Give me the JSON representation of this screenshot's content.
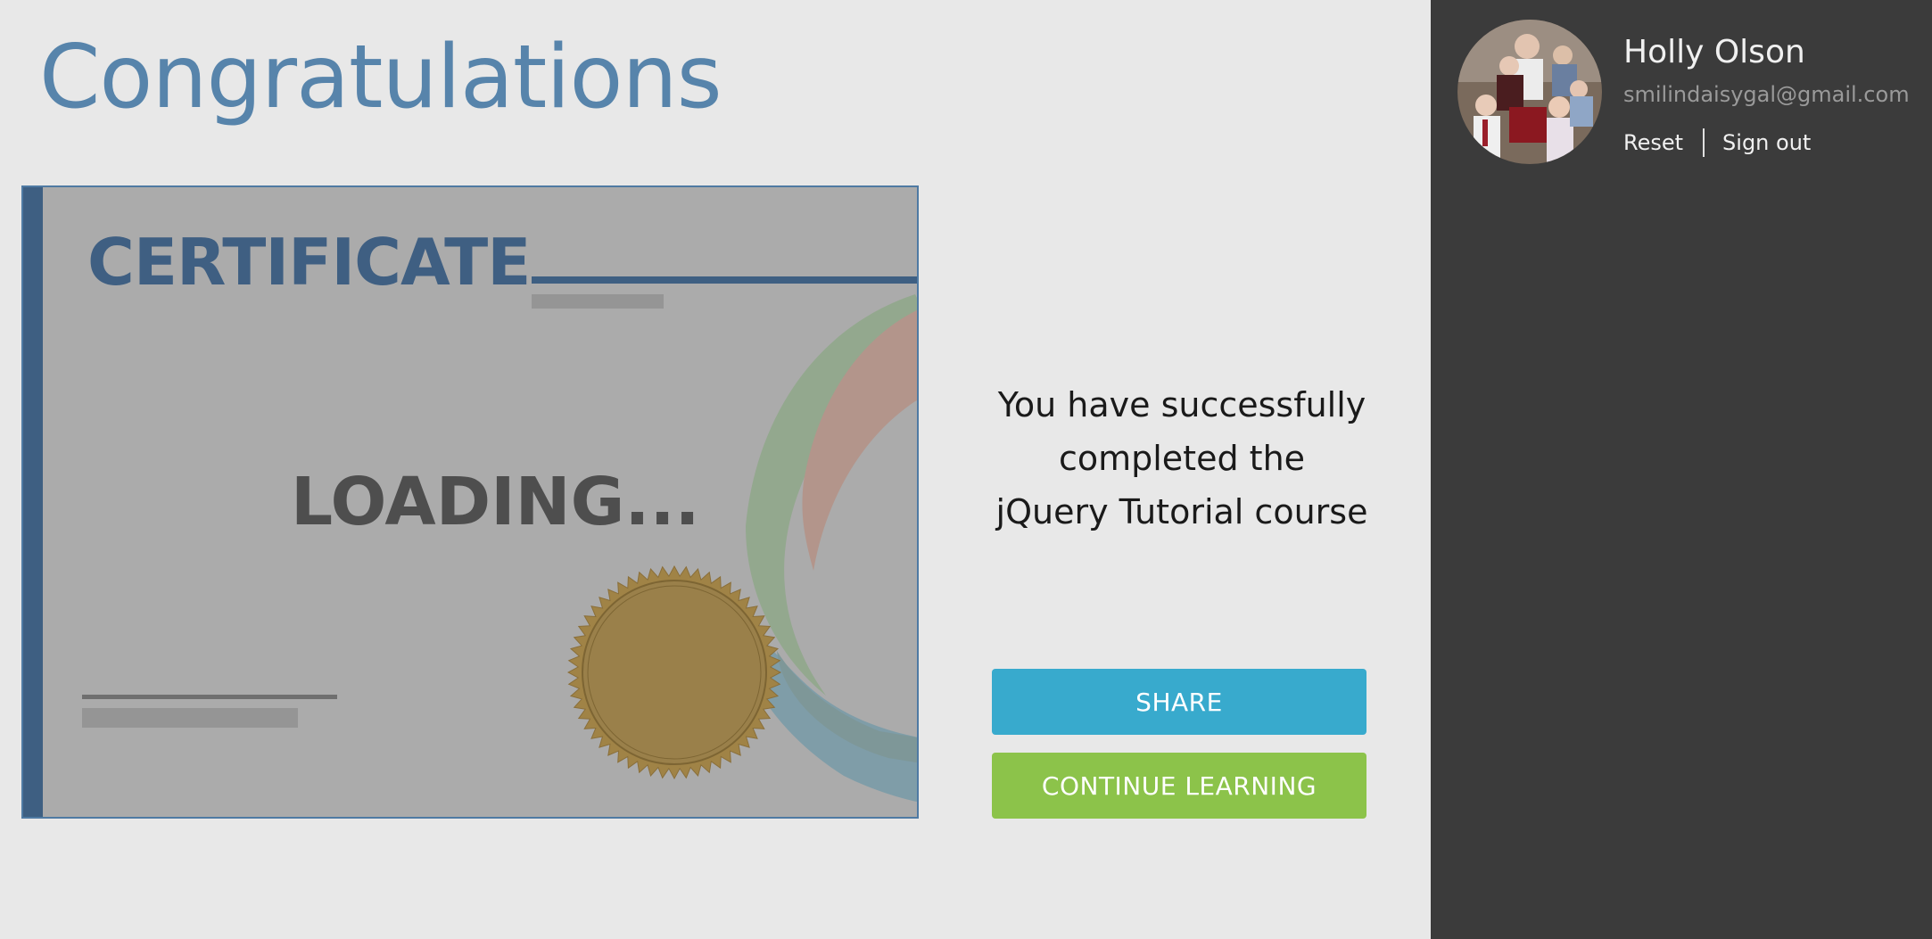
{
  "page": {
    "title": "Congratulations"
  },
  "certificate": {
    "heading": "CERTIFICATE",
    "loading_text": "LOADING...",
    "colors": {
      "accent": "#3e5f82",
      "background": "#ababab",
      "seal": "#a08346"
    }
  },
  "completion": {
    "lines": [
      "You have successfully",
      "completed the",
      "jQuery Tutorial course"
    ]
  },
  "actions": {
    "share_label": "SHARE",
    "continue_label": "CONTINUE LEARNING",
    "share_color": "#38aacd",
    "continue_color": "#8cc34a"
  },
  "user": {
    "name": "Holly Olson",
    "email": "smilindaisygal@gmail.com",
    "reset_label": "Reset",
    "signout_label": "Sign out",
    "avatar_icon": "family-photo-avatar"
  }
}
